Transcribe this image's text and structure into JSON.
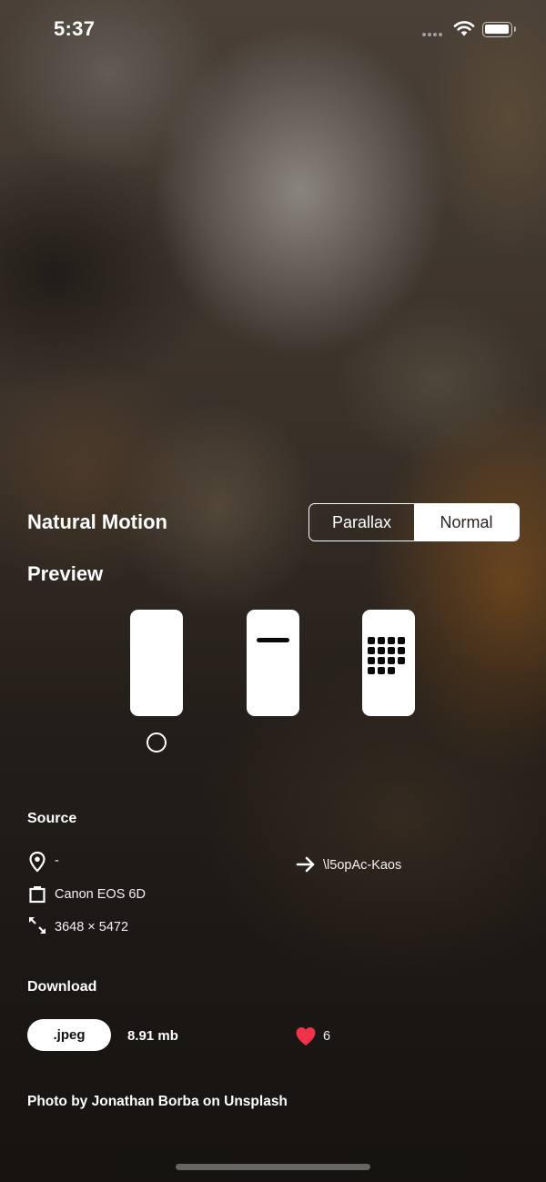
{
  "status_bar": {
    "time": "5:37"
  },
  "motion": {
    "title": "Natural Motion",
    "options": [
      "Parallax",
      "Normal"
    ],
    "selected": "Normal"
  },
  "preview": {
    "title": "Preview",
    "icons": [
      "phone-blank-icon",
      "phone-bar-icon",
      "phone-grid-icon"
    ],
    "selected_index": 0
  },
  "source": {
    "title": "Source",
    "location": "-",
    "camera": "Canon EOS 6D",
    "dimensions": "3648 × 5472",
    "link": "\\l5opAc-Kaos"
  },
  "download": {
    "title": "Download",
    "format_button": ".jpeg",
    "size": "8.91 mb",
    "likes": "6"
  },
  "credit": "Photo by Jonathan Borba on Unsplash",
  "colors": {
    "like_heart": "#f0324a",
    "accent": "#ffffff"
  }
}
